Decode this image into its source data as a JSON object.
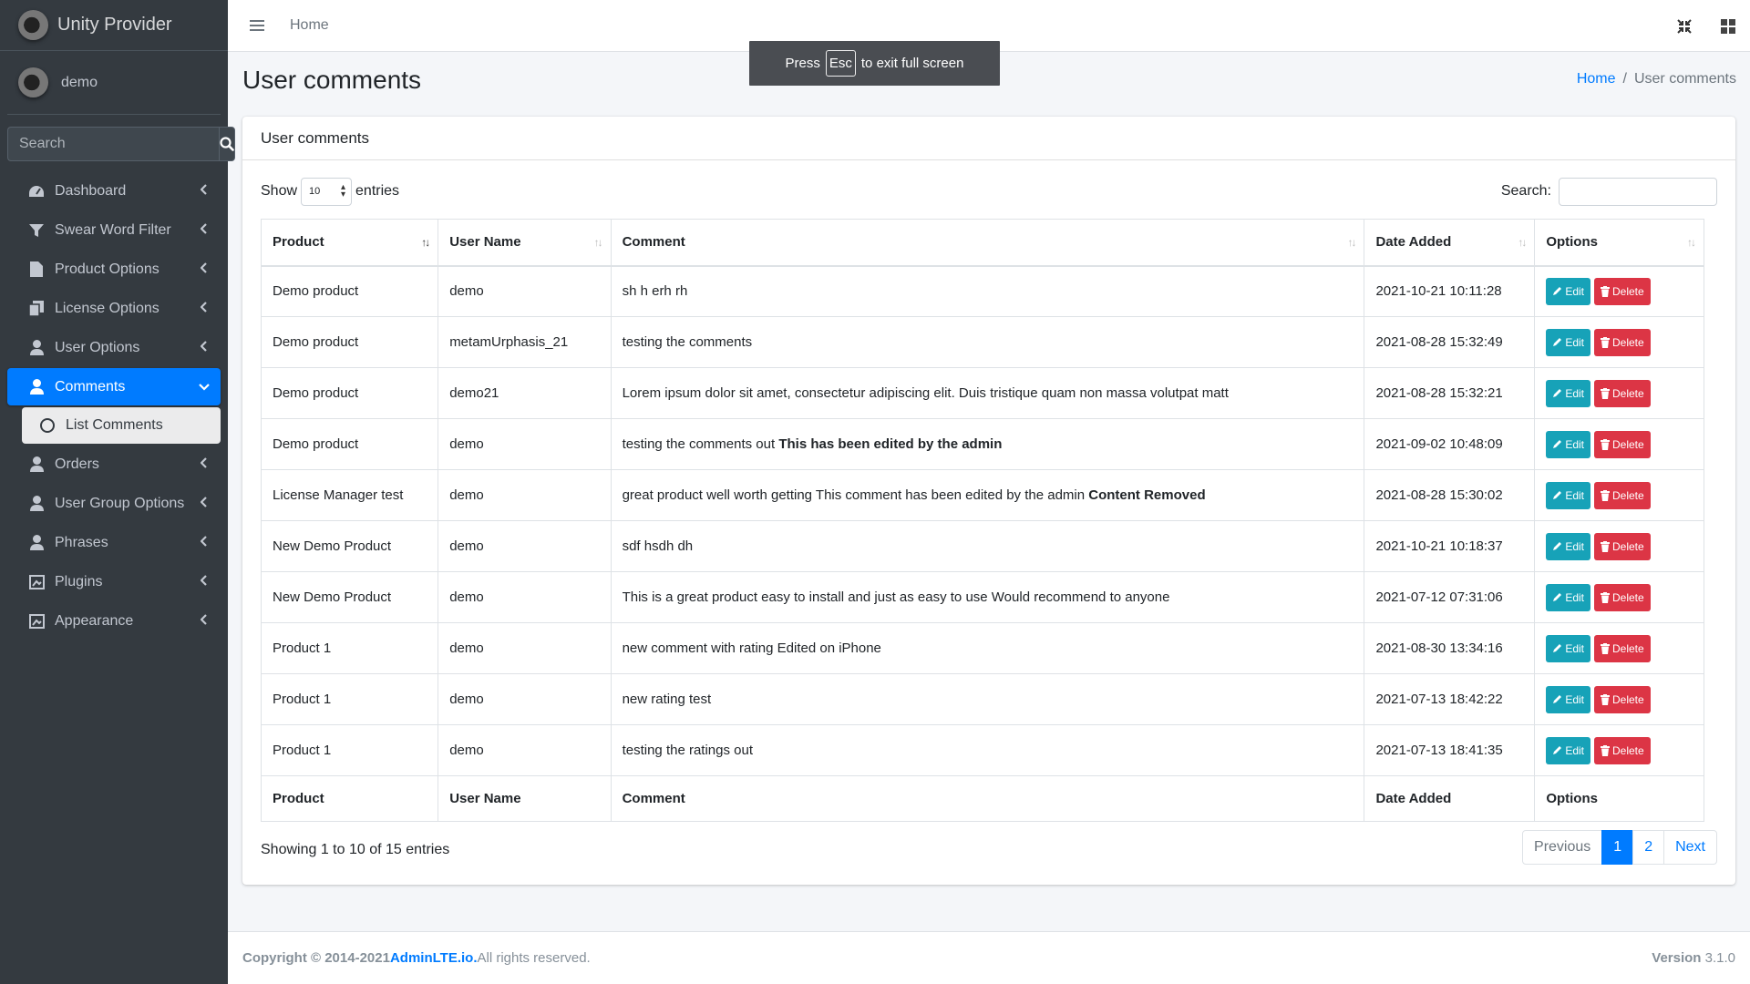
{
  "brand": {
    "name": "Unity Provider"
  },
  "user": {
    "name": "demo"
  },
  "sidebar_search": {
    "placeholder": "Search"
  },
  "nav": [
    {
      "label": "Dashboard",
      "icon": "tachometer-icon"
    },
    {
      "label": "Swear Word Filter",
      "icon": "filter-icon"
    },
    {
      "label": "Product Options",
      "icon": "file-icon"
    },
    {
      "label": "License Options",
      "icon": "copy-icon"
    },
    {
      "label": "User Options",
      "icon": "user-icon"
    },
    {
      "label": "Comments",
      "icon": "user-icon",
      "active": true
    },
    {
      "label": "List Comments",
      "icon": "circle-icon",
      "sub": true
    },
    {
      "label": "Orders",
      "icon": "user-icon"
    },
    {
      "label": "User Group Options",
      "icon": "user-icon"
    },
    {
      "label": "Phrases",
      "icon": "user-icon"
    },
    {
      "label": "Plugins",
      "icon": "plugin-icon"
    },
    {
      "label": "Appearance",
      "icon": "plugin-icon"
    }
  ],
  "topbar": {
    "home": "Home"
  },
  "fullscreen_toast": {
    "press": "Press",
    "key": "Esc",
    "rest": "to exit full screen"
  },
  "page": {
    "title": "User comments"
  },
  "breadcrumb": {
    "home": "Home",
    "sep": "/",
    "current": "User comments"
  },
  "card": {
    "title": "User comments"
  },
  "controls": {
    "show": "Show",
    "length": "10",
    "entries": "entries",
    "search_label": "Search:"
  },
  "table": {
    "columns": [
      "Product",
      "User Name",
      "Comment",
      "Date Added",
      "Options"
    ],
    "rows": [
      {
        "product": "Demo product",
        "user": "demo",
        "comment": "sh h erh rh",
        "bold": "",
        "date": "2021-10-21 10:11:28"
      },
      {
        "product": "Demo product",
        "user": "metamUrphasis_21",
        "comment": "testing the comments",
        "bold": "",
        "date": "2021-08-28 15:32:49"
      },
      {
        "product": "Demo product",
        "user": "demo21",
        "comment": "Lorem ipsum dolor sit amet, consectetur adipiscing elit. Duis tristique quam non massa volutpat matt",
        "bold": "",
        "date": "2021-08-28 15:32:21"
      },
      {
        "product": "Demo product",
        "user": "demo",
        "comment": "testing the comments out ",
        "bold": "This has been edited by the admin",
        "date": "2021-09-02 10:48:09"
      },
      {
        "product": "License Manager test",
        "user": "demo",
        "comment": "great product well worth getting This comment has been edited by the admin ",
        "bold": "Content Removed",
        "date": "2021-08-28 15:30:02"
      },
      {
        "product": "New Demo Product",
        "user": "demo",
        "comment": "sdf hsdh dh",
        "bold": "",
        "date": "2021-10-21 10:18:37"
      },
      {
        "product": "New Demo Product",
        "user": "demo",
        "comment": "This is a great product easy to install and just as easy to use Would recommend to anyone",
        "bold": "",
        "date": "2021-07-12 07:31:06"
      },
      {
        "product": "Product 1",
        "user": "demo",
        "comment": "new comment with rating Edited on iPhone",
        "bold": "",
        "date": "2021-08-30 13:34:16"
      },
      {
        "product": "Product 1",
        "user": "demo",
        "comment": "new rating test",
        "bold": "",
        "date": "2021-07-13 18:42:22"
      },
      {
        "product": "Product 1",
        "user": "demo",
        "comment": "testing the ratings out",
        "bold": "",
        "date": "2021-07-13 18:41:35"
      }
    ],
    "edit_label": "Edit",
    "delete_label": "Delete"
  },
  "info": "Showing 1 to 10 of 15 entries",
  "pager": {
    "previous": "Previous",
    "pages": [
      "1",
      "2"
    ],
    "next": "Next",
    "current": "1"
  },
  "footer": {
    "copyright": "Copyright © 2014-2021 ",
    "link": "AdminLTE.io.",
    "rights": " All rights reserved.",
    "version_label": "Version",
    "version": " 3.1.0"
  },
  "colors": {
    "primary": "#007bff",
    "info": "#17a2b8",
    "danger": "#dc3545",
    "sidebar": "#343a40"
  }
}
